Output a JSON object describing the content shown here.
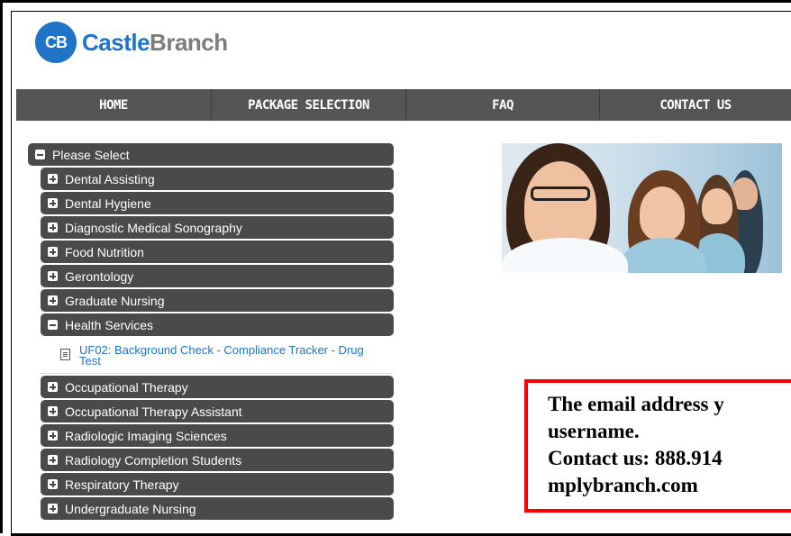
{
  "brand": {
    "logo_mark": "CB",
    "name_part1": "Castle",
    "name_part2": "Branch"
  },
  "nav": {
    "items": [
      "HOME",
      "PACKAGE SELECTION",
      "FAQ",
      "CONTACT US"
    ]
  },
  "menu": {
    "root_label": "Please Select",
    "items": [
      "Dental Assisting",
      "Dental Hygiene",
      "Diagnostic Medical Sonography",
      "Food Nutrition",
      "Gerontology",
      "Graduate Nursing",
      "Health Services",
      "Occupational Therapy",
      "Occupational Therapy Assistant",
      "Radiologic Imaging Sciences",
      "Radiology Completion Students",
      "Respiratory Therapy",
      "Undergraduate Nursing"
    ],
    "expanded_index": 6,
    "expanded_package": "UF02: Background Check - Compliance Tracker - Drug Test"
  },
  "alert": {
    "line1": "The email address y",
    "line2": "username.",
    "line3": "Contact us:  888.914",
    "line4": "   mplybranch.com"
  },
  "colors": {
    "brand_blue": "#1f74c7",
    "nav_bg": "#555555",
    "menu_bg": "#4a4a4a",
    "alert_border": "#ff0000"
  }
}
